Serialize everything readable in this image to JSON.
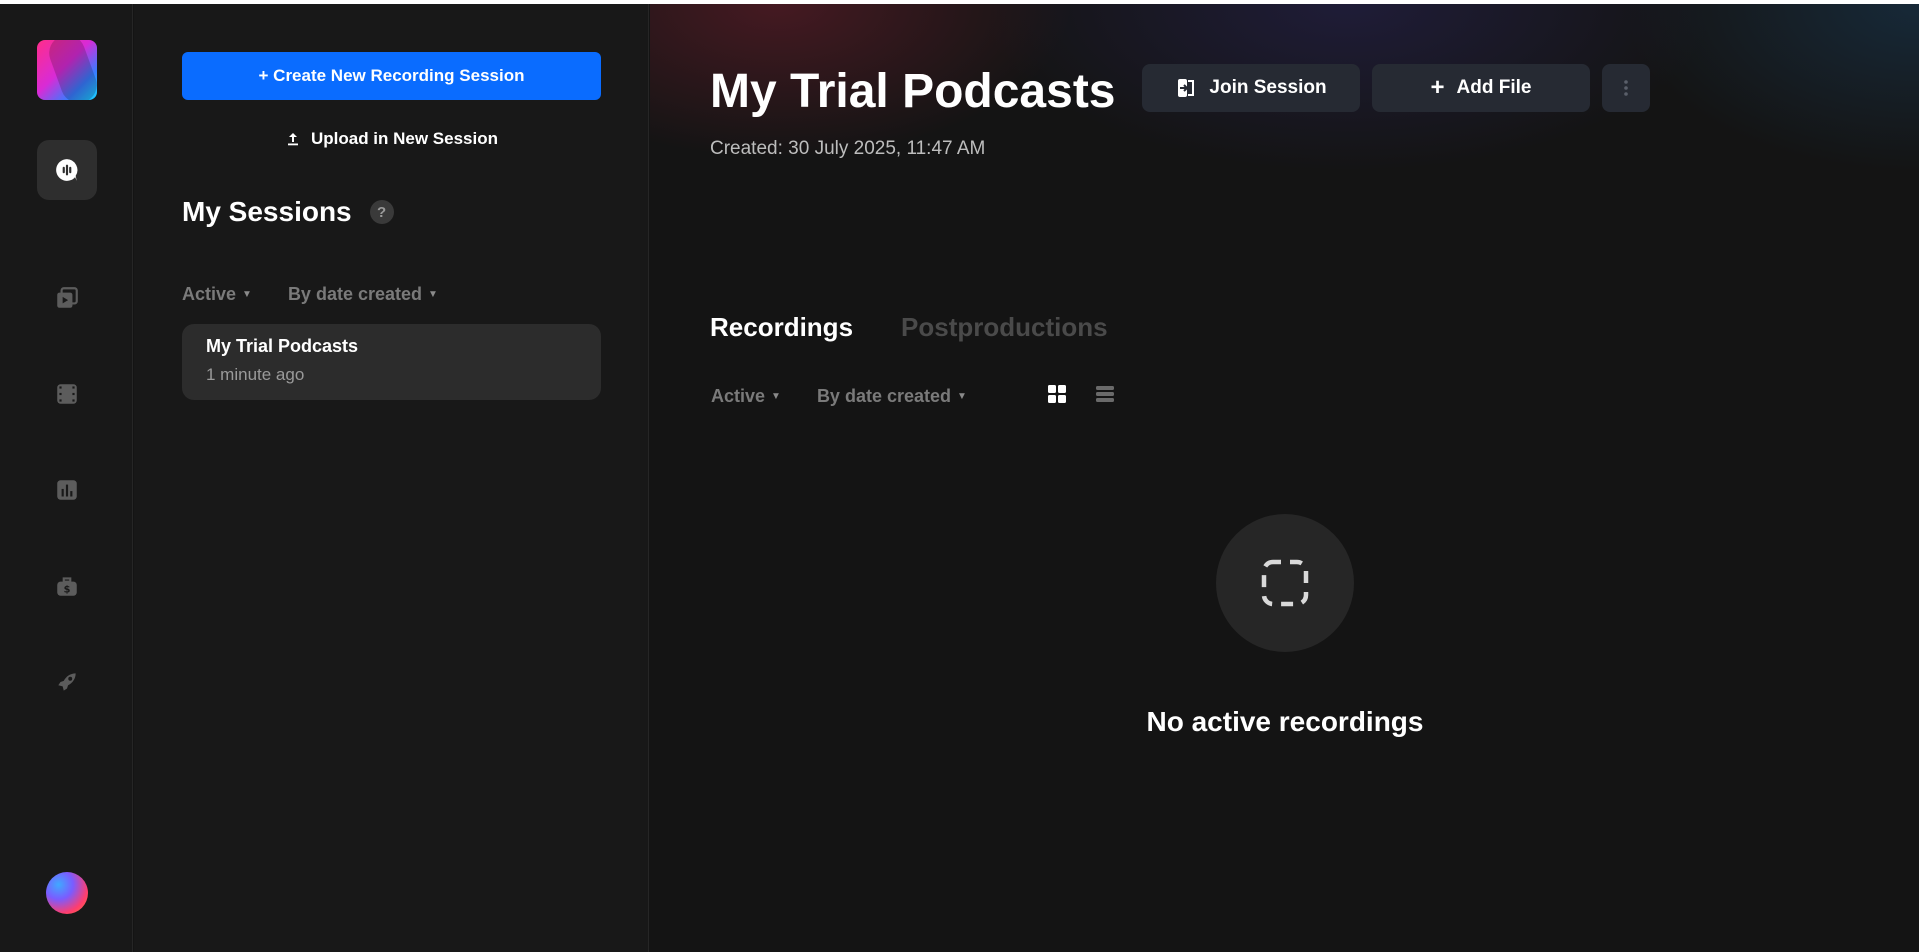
{
  "rail": {
    "nav": [
      {
        "name": "recordings",
        "icon": "podcast-mic-icon",
        "active": true
      },
      {
        "name": "clips",
        "icon": "video-stack-icon",
        "active": false
      },
      {
        "name": "video-editor",
        "icon": "film-icon",
        "active": false
      },
      {
        "name": "analytics",
        "icon": "bar-chart-icon",
        "active": false
      },
      {
        "name": "billing",
        "icon": "briefcase-dollar-icon",
        "active": false
      },
      {
        "name": "launch",
        "icon": "rocket-icon",
        "active": false
      }
    ]
  },
  "sessions_panel": {
    "create_button": "+ Create New Recording Session",
    "upload_label": "Upload in New Session",
    "title": "My Sessions",
    "help": "?",
    "filter_status": "Active",
    "filter_sort": "By date created",
    "sessions": [
      {
        "name": "My Trial Podcasts",
        "time": "1 minute ago"
      }
    ]
  },
  "main": {
    "title": "My Trial Podcasts",
    "created": "Created: 30 July 2025, 11:47 AM",
    "join_button": "Join Session",
    "add_file_button": "Add File",
    "tabs": [
      {
        "label": "Recordings",
        "active": true
      },
      {
        "label": "Postproductions",
        "active": false
      }
    ],
    "filter_status": "Active",
    "filter_sort": "By date created",
    "empty_message": "No active recordings"
  },
  "colors": {
    "primary": "#0a6cff",
    "chat": "#b57cff",
    "background": "#141414",
    "panel": "#181818"
  }
}
